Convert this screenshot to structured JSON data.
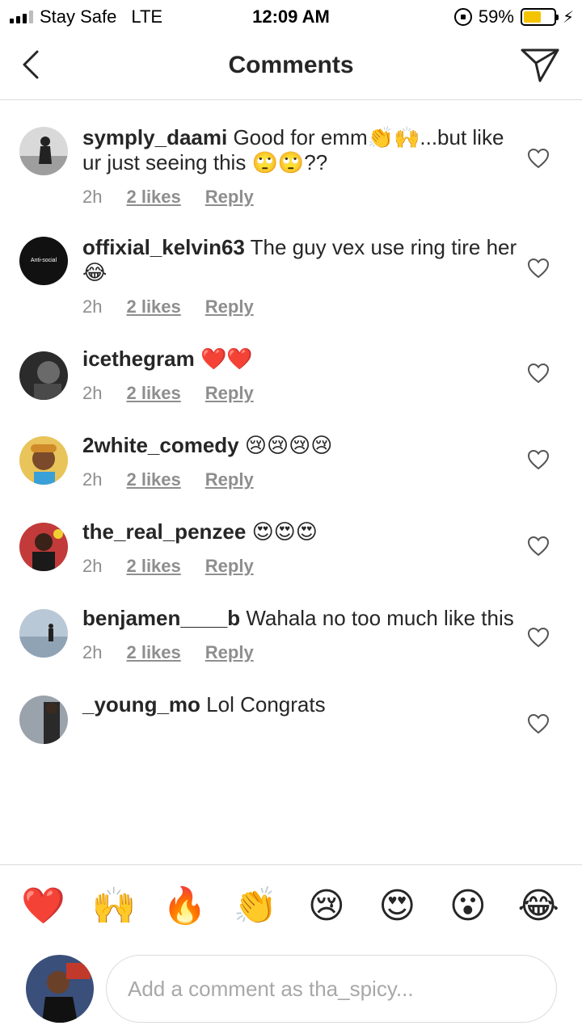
{
  "status_bar": {
    "carrier": "Stay Safe",
    "network": "LTE",
    "time": "12:09 AM",
    "battery": "59%",
    "battery_level": 0.59,
    "battery_color": "#f5c400"
  },
  "header": {
    "title": "Comments",
    "back_icon": "chevron-left-icon",
    "share_icon": "paper-plane-icon"
  },
  "comments": [
    {
      "user": "symply_daami",
      "text": "Good for emm👏🙌...but like ur just seeing this 🙄🙄??",
      "time": "2h",
      "likes": "2 likes",
      "reply": "Reply"
    },
    {
      "user": "offixial_kelvin63",
      "text": "The guy vex use ring tire her 😂",
      "time": "2h",
      "likes": "2 likes",
      "reply": "Reply",
      "avatar_text": "Anti-social"
    },
    {
      "user": "icethegram",
      "text": "❤️❤️",
      "time": "2h",
      "likes": "2 likes",
      "reply": "Reply"
    },
    {
      "user": "2white_comedy",
      "text": "😢😢😢😢",
      "time": "2h",
      "likes": "2 likes",
      "reply": "Reply"
    },
    {
      "user": "the_real_penzee",
      "text": "😍😍😍",
      "time": "2h",
      "likes": "2 likes",
      "reply": "Reply"
    },
    {
      "user": "benjamen____b",
      "text": "Wahala no too much like this",
      "time": "2h",
      "likes": "2 likes",
      "reply": "Reply"
    },
    {
      "user": "_young_mo",
      "text": "Lol Congrats",
      "time": "",
      "likes": "",
      "reply": ""
    }
  ],
  "emoji_bar": [
    "❤️",
    "🙌",
    "🔥",
    "👏",
    "😢",
    "😍",
    "😮",
    "😂"
  ],
  "composer": {
    "placeholder": "Add a comment as tha_spicy..."
  },
  "colors": {
    "text": "#262626",
    "secondary": "#8e8e8e",
    "divider": "#dbdbdb"
  }
}
